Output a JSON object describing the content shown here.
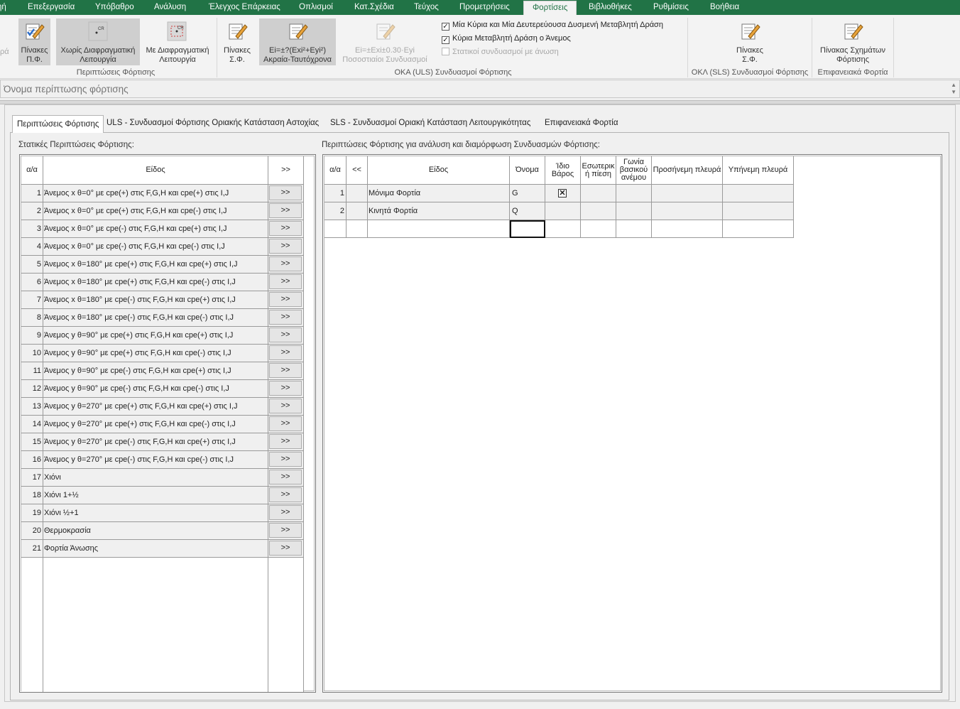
{
  "menu": {
    "items": [
      "ηή",
      "Επεξεργασία",
      "Υπόβαθρο",
      "Ανάλυση",
      "Έλεγχος Επάρκειας",
      "Οπλισμοί",
      "Κατ.Σχέδια",
      "Τεύχος",
      "Προμετρήσεις",
      "Φορτίσεις",
      "Βιβλιοθήκες",
      "Ρυθμίσεις",
      "Βοήθεια"
    ],
    "active": "Φορτίσεις"
  },
  "ribbon": {
    "partial_left": "ρά",
    "btn_pinakes_pf": "Πίνακες\nΠ.Φ.",
    "btn_xoris": "Χωρίς Διαφραγματική\nΛειτουργία",
    "btn_me": "Με Διαφραγματική\nΛειτουργία",
    "group1": "Περιπτώσεις Φόρτισης",
    "btn_pinakes_sf": "Πίνακες\nΣ.Φ.",
    "btn_ei_akraia": "Ei=±?(Exi²+Eyi²)\nΑκραία-Ταυτόχρονα",
    "btn_ei_pososto": "Ei=±Exi±0.30·Eyi\nΠοσοστιαίοι Συνδυασμοί",
    "chk1": "Μία Κύρια και Μία Δευτερεύουσα Δυσμενή Μεταβλητή Δράση",
    "chk2": "Κύρια Μεταβλητή Δράση ο Άνεμος",
    "chk3": "Στατικοί συνδυασμοί με άνωση",
    "group2": "ΟΚΑ (ULS) Συνδυασμοί Φόρτισης",
    "btn_pinakes_sf2": "Πίνακες\nΣ.Φ.",
    "group3": "ΟΚΛ (SLS) Συνδυασμοί Φόρτισης",
    "btn_pinakas_sx": "Πίνακας Σχημάτων\nΦόρτισης",
    "group4": "Επιφανειακά Φορτία"
  },
  "name_field": {
    "placeholder": "Όνομα περίπτωσης φόρτισης"
  },
  "tabs": [
    "Περιπτώσεις Φόρτισης",
    "ULS - Συνδυασμοί Φόρτισης Οριακής Κατάσταση Αστοχίας",
    "SLS - Συνδυασμοί Οριακή Κατάσταση Λειτουργικότητας",
    "Επιφανειακά Φορτία"
  ],
  "left": {
    "title": "Στατικές Περιπτώσεις Φόρτισης:",
    "headers": [
      "α/α",
      "Είδος",
      ">>"
    ],
    "btn": ">>",
    "rows": [
      [
        "1",
        "Άνεμος x θ=0° με cpe(+) στις F,G,H και cpe(+) στις I,J"
      ],
      [
        "2",
        "Άνεμος x θ=0° με cpe(+) στις F,G,H και cpe(-) στις I,J"
      ],
      [
        "3",
        "Άνεμος x θ=0° με cpe(-) στις F,G,H και cpe(+) στις I,J"
      ],
      [
        "4",
        "Άνεμος x θ=0° με cpe(-) στις F,G,H και cpe(-) στις I,J"
      ],
      [
        "5",
        "Άνεμος x θ=180° με cpe(+) στις F,G,H και cpe(+) στις I,J"
      ],
      [
        "6",
        "Άνεμος x θ=180° με cpe(+) στις F,G,H και cpe(-) στις I,J"
      ],
      [
        "7",
        "Άνεμος x θ=180° με cpe(-) στις F,G,H και cpe(+) στις I,J"
      ],
      [
        "8",
        "Άνεμος x θ=180° με cpe(-) στις F,G,H και cpe(-) στις I,J"
      ],
      [
        "9",
        "Άνεμος y θ=90° με cpe(+) στις F,G,H και cpe(+) στις I,J"
      ],
      [
        "10",
        "Άνεμος y θ=90° με cpe(+) στις F,G,H και cpe(-) στις I,J"
      ],
      [
        "11",
        "Άνεμος y θ=90° με cpe(-) στις F,G,H και cpe(+) στις I,J"
      ],
      [
        "12",
        "Άνεμος y θ=90° με cpe(-) στις F,G,H και cpe(-) στις I,J"
      ],
      [
        "13",
        "Άνεμος y θ=270° με cpe(+) στις F,G,H και cpe(+) στις I,J"
      ],
      [
        "14",
        "Άνεμος y θ=270° με cpe(+) στις F,G,H και cpe(-) στις I,J"
      ],
      [
        "15",
        "Άνεμος y θ=270° με cpe(-) στις F,G,H και cpe(+) στις I,J"
      ],
      [
        "16",
        "Άνεμος y θ=270° με cpe(-) στις F,G,H και cpe(-) στις I,J"
      ],
      [
        "17",
        "Χιόνι"
      ],
      [
        "18",
        "Χιόνι 1+½"
      ],
      [
        "19",
        "Χιόνι ½+1"
      ],
      [
        "20",
        "Θερμοκρασία"
      ],
      [
        "21",
        "Φορτία Άνωσης"
      ]
    ]
  },
  "right": {
    "title": "Περιπτώσεις Φόρτισης για ανάλυση και διαμόρφωση Συνδυασμών Φόρτισης:",
    "headers": [
      "α/α",
      "<<",
      "Είδος",
      "Όνομα",
      "Ίδιο\nΒάρος",
      "Εσωτερικ\nή πίεση",
      "Γωνία\nβασικού\nανέμου",
      "Προσήνεμη πλευρά",
      "Υπήνεμη πλευρά"
    ],
    "rows": [
      {
        "n": "1",
        "eidos": "Μόνιμα Φορτία",
        "onoma": "G",
        "idio": true
      },
      {
        "n": "2",
        "eidos": "Κινητά Φορτία",
        "onoma": "Q",
        "idio": false
      }
    ]
  }
}
